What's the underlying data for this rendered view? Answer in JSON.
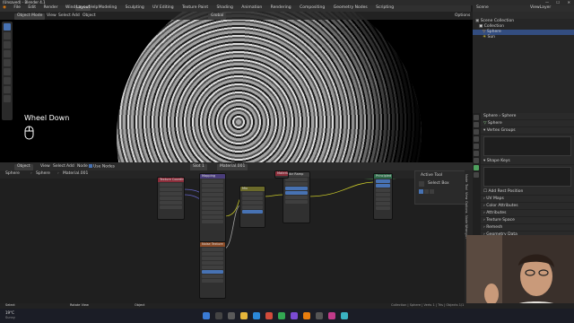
{
  "window": {
    "title": "(Unsaved) - Blender 4.1",
    "minimize": "—",
    "maximize": "☐",
    "close": "✕"
  },
  "menus": [
    "File",
    "Edit",
    "Render",
    "Window",
    "Help"
  ],
  "workspaces": [
    "Layout",
    "Modeling",
    "Sculpting",
    "UV Editing",
    "Texture Paint",
    "Shading",
    "Animation",
    "Rendering",
    "Compositing",
    "Geometry Nodes",
    "Scripting"
  ],
  "active_workspace": "Layout",
  "top_right": {
    "scene": "Scene",
    "view_layer": "ViewLayer"
  },
  "viewport": {
    "mode": "Object Mode",
    "menus": [
      "View",
      "Select",
      "Add",
      "Object"
    ],
    "transform": "Global",
    "options": "Options",
    "overlay_text": "Wheel Down"
  },
  "outliner": {
    "title": "Scene Collection",
    "rows": [
      {
        "label": "Scene Collection",
        "selected": false
      },
      {
        "label": "Collection",
        "selected": false
      },
      {
        "label": "Sphere",
        "selected": true
      },
      {
        "label": "Sun",
        "selected": false
      }
    ]
  },
  "properties": {
    "breadcrumb_obj": "Sphere",
    "breadcrumb_data": "Sphere",
    "data_name": "Sphere",
    "sections": [
      "Vertex Groups",
      "Shape Keys",
      "Add Rest Position",
      "UV Maps",
      "Color Attributes",
      "Attributes",
      "Texture Space",
      "Remesh",
      "Geometry Data",
      "Custom Properties"
    ]
  },
  "node_editor": {
    "mode": "Object",
    "menus": [
      "View",
      "Select",
      "Add",
      "Node"
    ],
    "use_nodes": "Use Nodes",
    "slot": "Slot 1",
    "material": "Material.001",
    "breadcrumb": [
      "Sphere",
      "Sphere",
      "Material.001"
    ],
    "active_tool": {
      "title": "Active Tool",
      "tool": "Select Box"
    },
    "side_tabs": [
      "Node",
      "Tool",
      "View",
      "Options",
      "Node Wrangler"
    ],
    "nodes": [
      {
        "title": "Texture Coordinate",
        "header_color": "#8b2d3a"
      },
      {
        "title": "Mapping",
        "header_color": "#4a3d7a"
      },
      {
        "title": "Mix",
        "header_color": "#6b6a2a"
      },
      {
        "title": "Noise Texture",
        "header_color": "#8a4b27"
      },
      {
        "title": "Color Ramp",
        "header_color": "#3d3d3d"
      },
      {
        "title": "Principled BSDF",
        "header_color": "#2e6b4a"
      },
      {
        "title": "Material Output",
        "header_color": "#8b2d3a"
      }
    ]
  },
  "status": {
    "select": "Select",
    "rotate": "Rotate View",
    "object": "Object",
    "info": "Collection | Sphere | Verts 1 | Tris | Objects 1/1"
  },
  "taskbar": {
    "weather": "19°C",
    "weather_sub": "Sunny"
  }
}
